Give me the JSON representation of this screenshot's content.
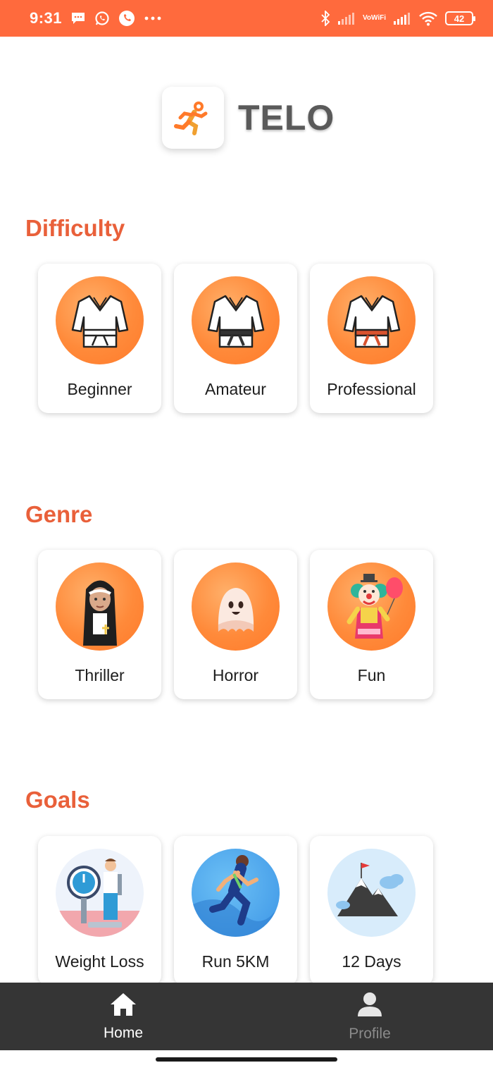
{
  "status_bar": {
    "time": "9:31",
    "battery_level": "42",
    "vowifi_top": "Vo",
    "vowifi_bottom": "WiFi",
    "left_icons": [
      "message-icon",
      "whatsapp-icon",
      "phone-call-icon",
      "more-dots-icon"
    ],
    "right_icons": [
      "bluetooth-icon",
      "signal-icon",
      "vowifi-icon",
      "signal-icon",
      "wifi-icon",
      "battery-icon"
    ]
  },
  "app": {
    "name": "TELO",
    "logo_icon": "running-person-icon"
  },
  "sections": {
    "difficulty": {
      "title": "Difficulty",
      "items": [
        {
          "label": "Beginner",
          "icon": "white-belt-gi-icon"
        },
        {
          "label": "Amateur",
          "icon": "black-belt-gi-icon"
        },
        {
          "label": "Professional",
          "icon": "red-belt-gi-icon"
        }
      ]
    },
    "genre": {
      "title": "Genre",
      "items": [
        {
          "label": "Thriller",
          "icon": "nun-icon"
        },
        {
          "label": "Horror",
          "icon": "ghost-icon"
        },
        {
          "label": "Fun",
          "icon": "clown-icon"
        }
      ]
    },
    "goals": {
      "title": "Goals",
      "items": [
        {
          "label": "Weight Loss",
          "icon": "weighing-scale-icon"
        },
        {
          "label": "Run 5KM",
          "icon": "runner-icon"
        },
        {
          "label": "12 Days",
          "icon": "mountain-flag-icon"
        }
      ]
    }
  },
  "bottom_nav": {
    "items": [
      {
        "label": "Home",
        "icon": "home-icon",
        "active": true
      },
      {
        "label": "Profile",
        "icon": "person-icon",
        "active": false
      }
    ]
  },
  "colors": {
    "status_bar": "#ff6a3d",
    "accent": "#e9603a",
    "circle": "#ff8a3a",
    "nav_background": "#353535"
  }
}
